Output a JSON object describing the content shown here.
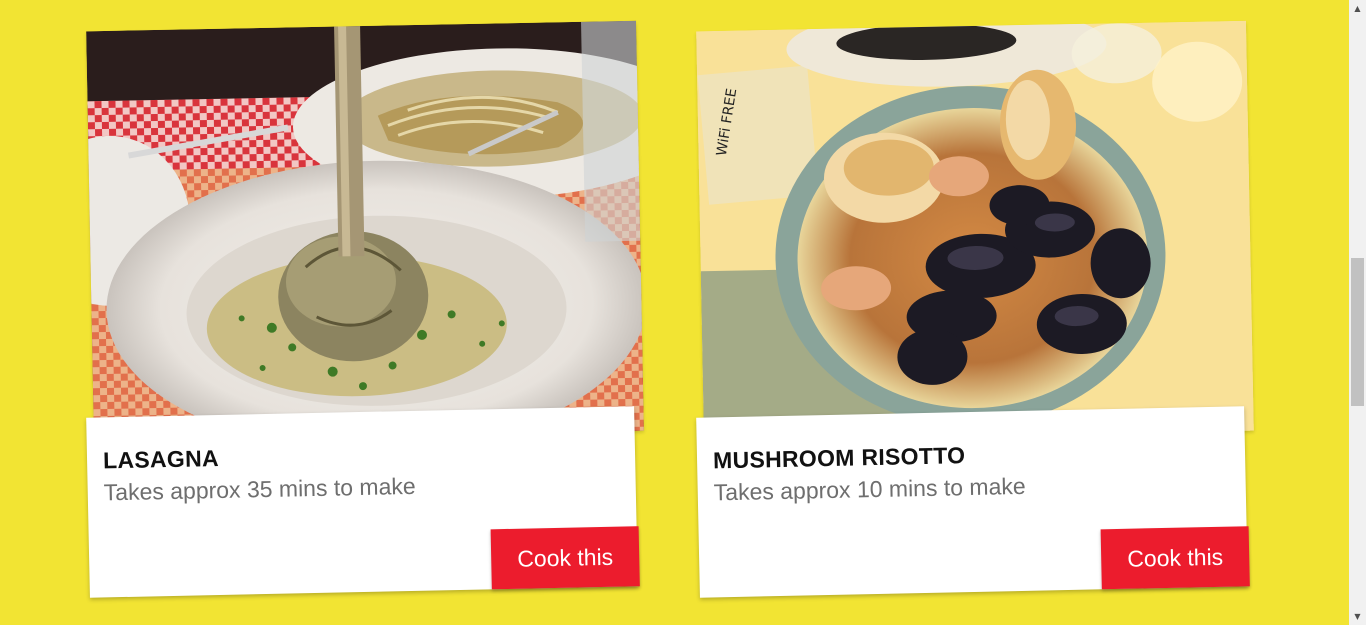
{
  "recipes": [
    {
      "title": "LASAGNA",
      "subtitle": "Takes approx 35 mins to make",
      "button_label": "Cook this"
    },
    {
      "title": "MUSHROOM RISOTTO",
      "subtitle": "Takes approx 10 mins to make",
      "button_label": "Cook this"
    }
  ],
  "colors": {
    "background": "#f2e433",
    "button": "#ec1c2d",
    "panel": "#ffffff"
  },
  "scrollbar": {
    "up_arrow": "▲",
    "down_arrow": "▼"
  }
}
